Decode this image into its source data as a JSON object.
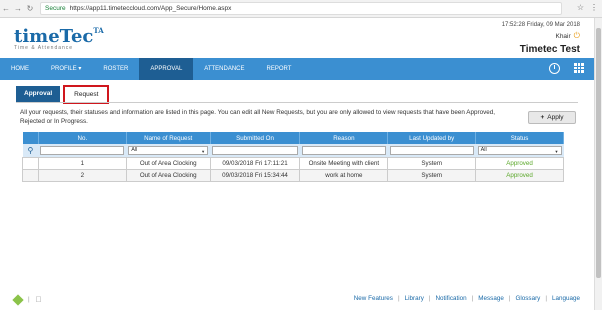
{
  "browser": {
    "secure_label": "Secure",
    "url": "https://app11.timeteccloud.com/App_Secure/Home.aspx"
  },
  "header": {
    "logo_text": "timeTec",
    "logo_sup": "TA",
    "logo_tagline": "Time & Attendance",
    "datetime": "17:52:28 Friday, 09 Mar 2018",
    "user": "Khair",
    "company": "Timetec Test"
  },
  "menu": {
    "items": [
      {
        "label": "HOME"
      },
      {
        "label": "PROFILE ▾"
      },
      {
        "label": "ROSTER"
      },
      {
        "label": "APPROVAL"
      },
      {
        "label": "ATTENDANCE"
      },
      {
        "label": "REPORT"
      }
    ],
    "active_index": 3
  },
  "tabs": {
    "approval": "Approval",
    "request": "Request"
  },
  "description": "All your requests, their statuses and information are listed in this page. You can edit all New Requests, but you are only allowed to view requests that have been Approved, Rejected or In Progress.",
  "apply_label": "Apply",
  "table": {
    "headers": [
      "No.",
      "Name of Request",
      "Submitted On",
      "Reason",
      "Last Updated by",
      "Status"
    ],
    "filter": {
      "name_select": "All",
      "status_select": "All"
    },
    "rows": [
      {
        "no": "1",
        "name": "Out of Area Clocking",
        "submitted": "09/03/2018 Fri 17:11:21",
        "reason": "Onsite Meeting with client",
        "updated_by": "System",
        "status": "Approved"
      },
      {
        "no": "2",
        "name": "Out of Area Clocking",
        "submitted": "09/03/2018 Fri 15:34:44",
        "reason": "work at home",
        "updated_by": "System",
        "status": "Approved"
      }
    ]
  },
  "footer": {
    "links": [
      "New Features",
      "Library",
      "Notification",
      "Message",
      "Glossary",
      "Language"
    ]
  },
  "colors": {
    "brand": "#1a6aa8",
    "menu_bg": "#3b8fd1",
    "menu_active": "#1e5e93",
    "approved": "#5ba82a",
    "highlight": "#d0161d"
  }
}
